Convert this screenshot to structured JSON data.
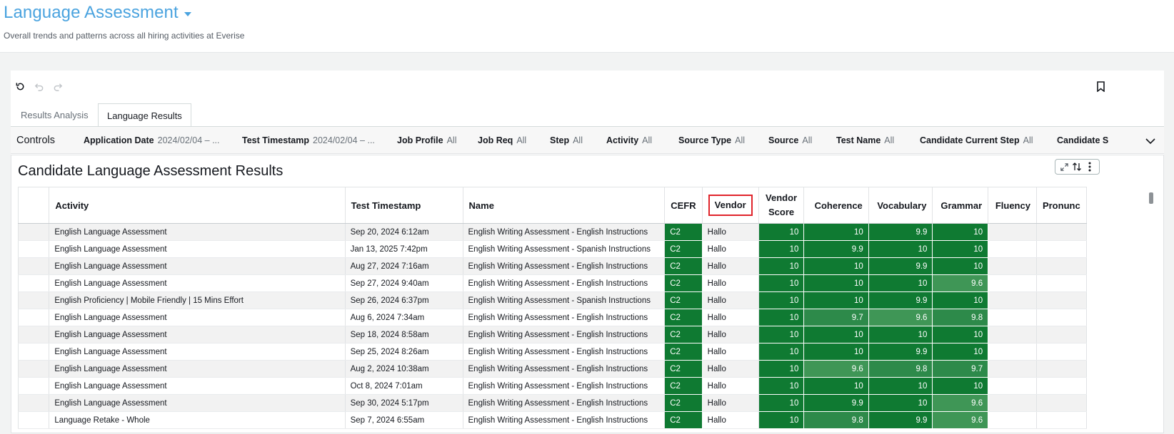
{
  "header": {
    "title": "Language Assessment",
    "subtitle": "Overall trends and patterns across all hiring activities at Everise"
  },
  "tabs": [
    {
      "label": "Results Analysis",
      "active": false
    },
    {
      "label": "Language Results",
      "active": true
    }
  ],
  "controls": {
    "label": "Controls",
    "filters": [
      {
        "name": "Application Date",
        "value": "2024/02/04 – ..."
      },
      {
        "name": "Test Timestamp",
        "value": "2024/02/04 – ..."
      },
      {
        "name": "Job Profile",
        "value": "All"
      },
      {
        "name": "Job Req",
        "value": "All"
      },
      {
        "name": "Step",
        "value": "All"
      },
      {
        "name": "Activity",
        "value": "All"
      },
      {
        "name": "Source Type",
        "value": "All"
      },
      {
        "name": "Source",
        "value": "All"
      },
      {
        "name": "Test Name",
        "value": "All"
      },
      {
        "name": "Candidate Current Step",
        "value": "All"
      },
      {
        "name": "Candidate S",
        "value": ""
      }
    ]
  },
  "visual": {
    "title": "Candidate Language Assessment Results"
  },
  "table": {
    "columns": {
      "activity": "Activity",
      "timestamp": "Test Timestamp",
      "name": "Name",
      "cefr": "CEFR",
      "vendor": "Vendor",
      "vendor_score_1": "Vendor",
      "vendor_score_2": "Score",
      "coherence": "Coherence",
      "vocabulary": "Vocabulary",
      "grammar": "Grammar",
      "fluency": "Fluency",
      "pronunciation": "Pronunc"
    },
    "rows": [
      {
        "activity": "English Language Assessment",
        "timestamp": "Sep 20, 2024 6:12am",
        "name": "English Writing Assessment - English Instructions",
        "cefr": "C2",
        "vendor": "Hallo",
        "vendor_score": "10",
        "coherence": "10",
        "vocabulary": "9.9",
        "grammar": "10"
      },
      {
        "activity": "English Language Assessment",
        "timestamp": "Jan 13, 2025 7:42pm",
        "name": "English Writing Assessment - Spanish Instructions",
        "cefr": "C2",
        "vendor": "Hallo",
        "vendor_score": "10",
        "coherence": "9.9",
        "vocabulary": "10",
        "grammar": "10"
      },
      {
        "activity": "English Language Assessment",
        "timestamp": "Aug 27, 2024 7:16am",
        "name": "English Writing Assessment - English Instructions",
        "cefr": "C2",
        "vendor": "Hallo",
        "vendor_score": "10",
        "coherence": "10",
        "vocabulary": "9.9",
        "grammar": "10"
      },
      {
        "activity": "English Language Assessment",
        "timestamp": "Sep 27, 2024 9:40am",
        "name": "English Writing Assessment - English Instructions",
        "cefr": "C2",
        "vendor": "Hallo",
        "vendor_score": "10",
        "coherence": "10",
        "vocabulary": "10",
        "grammar": "9.6"
      },
      {
        "activity": "English Proficiency | Mobile Friendly | 15 Mins Effort",
        "timestamp": "Sep 26, 2024 6:37pm",
        "name": "English Writing Assessment - Spanish Instructions",
        "cefr": "C2",
        "vendor": "Hallo",
        "vendor_score": "10",
        "coherence": "10",
        "vocabulary": "9.9",
        "grammar": "10"
      },
      {
        "activity": "English Language Assessment",
        "timestamp": "Aug 6, 2024 7:34am",
        "name": "English Writing Assessment - English Instructions",
        "cefr": "C2",
        "vendor": "Hallo",
        "vendor_score": "10",
        "coherence": "9.7",
        "vocabulary": "9.6",
        "grammar": "9.8"
      },
      {
        "activity": "English Language Assessment",
        "timestamp": "Sep 18, 2024 8:58am",
        "name": "English Writing Assessment - English Instructions",
        "cefr": "C2",
        "vendor": "Hallo",
        "vendor_score": "10",
        "coherence": "10",
        "vocabulary": "10",
        "grammar": "10"
      },
      {
        "activity": "English Language Assessment",
        "timestamp": "Sep 25, 2024 8:26am",
        "name": "English Writing Assessment - English Instructions",
        "cefr": "C2",
        "vendor": "Hallo",
        "vendor_score": "10",
        "coherence": "10",
        "vocabulary": "9.9",
        "grammar": "10"
      },
      {
        "activity": "English Language Assessment",
        "timestamp": "Aug 2, 2024 10:38am",
        "name": "English Writing Assessment - English Instructions",
        "cefr": "C2",
        "vendor": "Hallo",
        "vendor_score": "10",
        "coherence": "9.6",
        "vocabulary": "9.8",
        "grammar": "9.7"
      },
      {
        "activity": "English Language Assessment",
        "timestamp": "Oct 8, 2024 7:01am",
        "name": "English Writing Assessment - English Instructions",
        "cefr": "C2",
        "vendor": "Hallo",
        "vendor_score": "10",
        "coherence": "10",
        "vocabulary": "10",
        "grammar": "10"
      },
      {
        "activity": "English Language Assessment",
        "timestamp": "Sep 30, 2024 5:17pm",
        "name": "English Writing Assessment - English Instructions",
        "cefr": "C2",
        "vendor": "Hallo",
        "vendor_score": "10",
        "coherence": "9.9",
        "vocabulary": "10",
        "grammar": "9.6"
      },
      {
        "activity": "Language Retake - Whole",
        "timestamp": "Sep 7, 2024 6:55am",
        "name": "English Writing Assessment - English Instructions",
        "cefr": "C2",
        "vendor": "Hallo",
        "vendor_score": "10",
        "coherence": "9.8",
        "vocabulary": "9.9",
        "grammar": "9.6"
      }
    ]
  },
  "colors": {
    "title": "#4aa3df",
    "score_high": "#0f7a32",
    "score_mid": "#2d8a4a",
    "highlight_border": "#e0242b"
  },
  "icons": [
    "undo-icon",
    "undo-arrow-icon",
    "redo-arrow-icon",
    "bookmark-icon",
    "chevron-down-icon",
    "expand-icon",
    "sort-icon",
    "more-vertical-icon"
  ]
}
